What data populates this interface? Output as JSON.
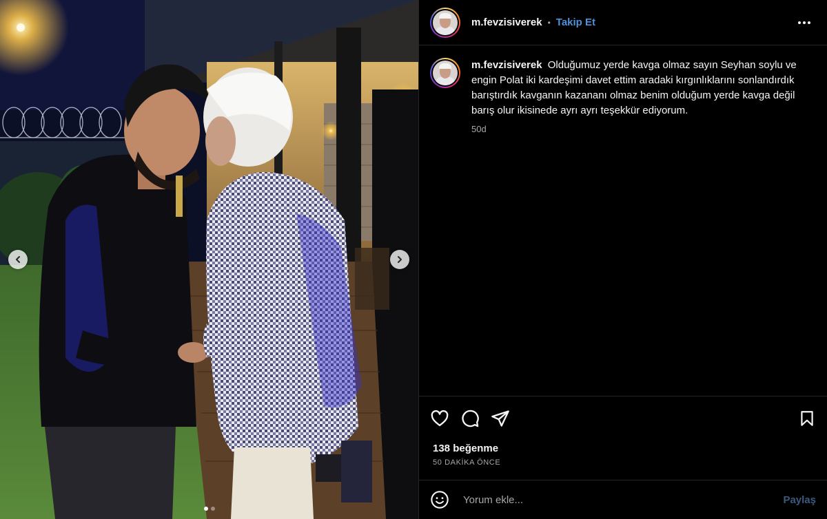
{
  "post": {
    "username": "m.fevzisiverek",
    "follow_label": "Takip Et",
    "separator": "•",
    "caption": "Olduğumuz yerde kavga olmaz sayın Seyhan soylu ve engin Polat iki kardeşimi davet ettim aradaki kırgınlıklarını sonlandırdık barıştırdık kavganın kazananı olmaz benim olduğum yerde kavga değil barış olur ikisinede ayrı ayrı teşekkür ediyorum.",
    "time_ago": "50d",
    "likes": "138 beğenme",
    "posted": "50 DAKİKA ÖNCE"
  },
  "comment": {
    "placeholder": "Yorum ekle...",
    "post_label": "Paylaş"
  },
  "media": {
    "slide_count": 2,
    "active_slide": 0
  },
  "icons": {
    "more": "more-options-icon",
    "like": "heart-icon",
    "comment": "comment-icon",
    "share": "paper-plane-icon",
    "save": "bookmark-icon",
    "emoji": "emoji-icon",
    "prev": "chevron-left-icon",
    "next": "chevron-right-icon"
  },
  "colors": {
    "follow": "#4f90d9",
    "post_button": "#3c5a7e",
    "background": "#000000"
  }
}
